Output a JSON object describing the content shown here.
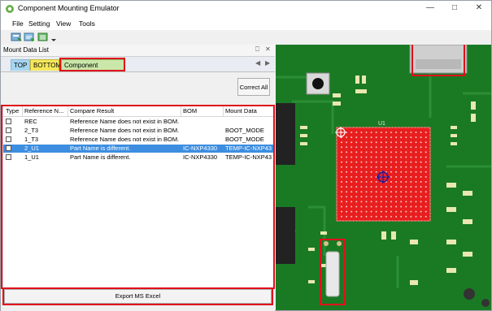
{
  "window": {
    "title": "Component Mounting Emulator"
  },
  "menu": [
    "File",
    "Setting",
    "View",
    "Tools"
  ],
  "panel": {
    "title": "Mount Data List",
    "tabs": [
      {
        "label": "TOP",
        "color": "#a6d6f0"
      },
      {
        "label": "BOTTOM",
        "color": "#f5e85c"
      },
      {
        "label": "Component Matching",
        "color": "#c9e7a8"
      }
    ],
    "correct_all_label": "Correct All",
    "export_label": "Export MS Excel"
  },
  "table": {
    "columns": [
      "Type",
      "Reference N...",
      "Compare Result",
      "BOM",
      "Mount Data"
    ],
    "rows": [
      {
        "type": "",
        "ref": "REC",
        "result": "Reference Name does not exist in BOM.",
        "bom": "",
        "mount": "",
        "selected": false
      },
      {
        "type": "",
        "ref": "2_T3",
        "result": "Reference Name does not exist in BOM.",
        "bom": "",
        "mount": "BOOT_MODE",
        "selected": false
      },
      {
        "type": "",
        "ref": "1_T3",
        "result": "Reference Name does not exist in BOM.",
        "bom": "",
        "mount": "BOOT_MODE",
        "selected": false
      },
      {
        "type": "",
        "ref": "2_U1",
        "result": "Part Name is different.",
        "bom": "IC-NXP4330",
        "mount": "TEMP-IC-NXP43",
        "selected": true
      },
      {
        "type": "",
        "ref": "1_U1",
        "result": "Part Name is different.",
        "bom": "IC-NXP4330",
        "mount": "TEMP-IC-NXP43",
        "selected": false
      }
    ]
  },
  "board": {
    "chip_label": "U1",
    "pcb_color": "#1a7a24",
    "pad_color": "#e8e8b0",
    "highlight_color": "#e0101a"
  },
  "icons": [
    "app-icon",
    "minimize-icon",
    "maximize-icon",
    "close-icon",
    "pin-icon",
    "tab-prev-icon",
    "tab-next-icon"
  ]
}
